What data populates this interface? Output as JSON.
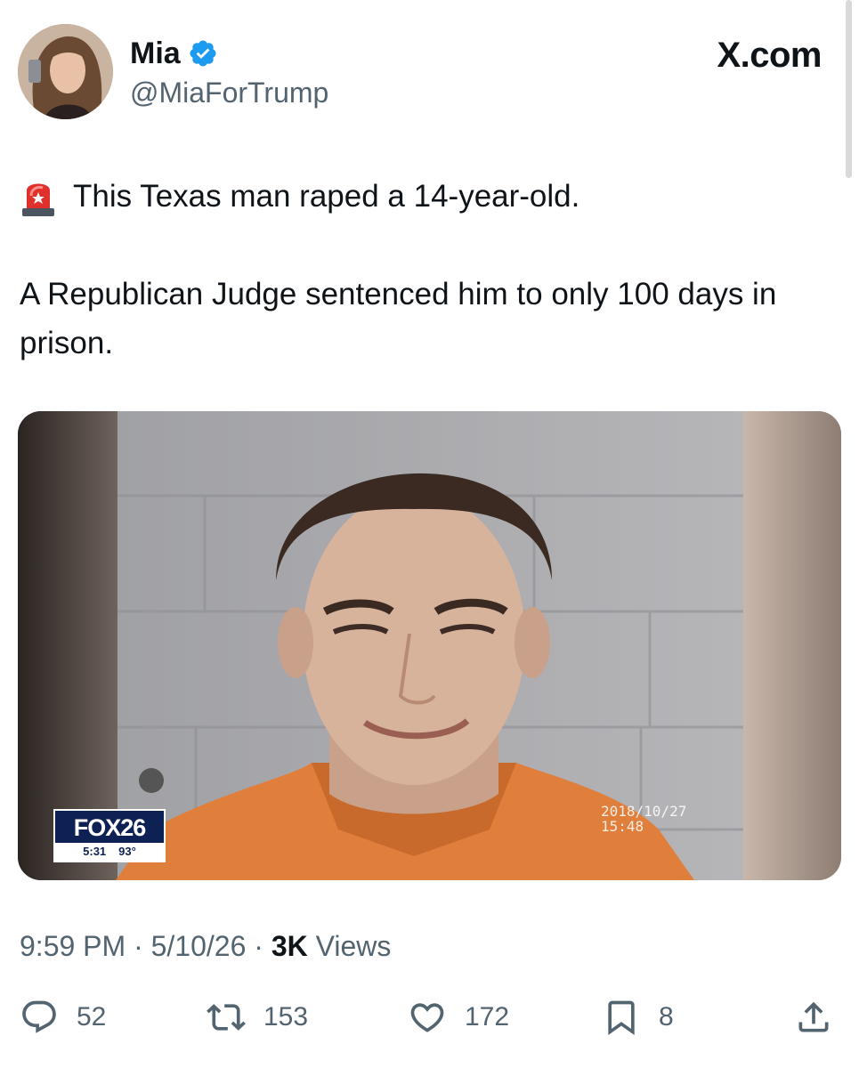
{
  "brand": "X.com",
  "author": {
    "display_name": "Mia",
    "handle": "@MiaForTrump",
    "verified": true,
    "verified_color": "#1d9bf0"
  },
  "tweet": {
    "emoji": "police-light-icon",
    "line1": "This Texas man raped a 14-year-old.",
    "line2": "A Republican Judge sentenced him to only 100 days in prison."
  },
  "media": {
    "logo_text": "FOX26",
    "logo_time": "5:31",
    "logo_temp": "93°",
    "overlay_date": "2018/10/27",
    "overlay_time": "15:48"
  },
  "meta": {
    "time": "9:59 PM",
    "date": "5/10/26",
    "views_count": "3K",
    "views_label": "Views"
  },
  "actions": {
    "replies": "52",
    "reposts": "153",
    "likes": "172",
    "bookmarks": "8"
  },
  "colors": {
    "text": "#0f1419",
    "secondary": "#536471",
    "fox_blue": "#0e2155"
  }
}
